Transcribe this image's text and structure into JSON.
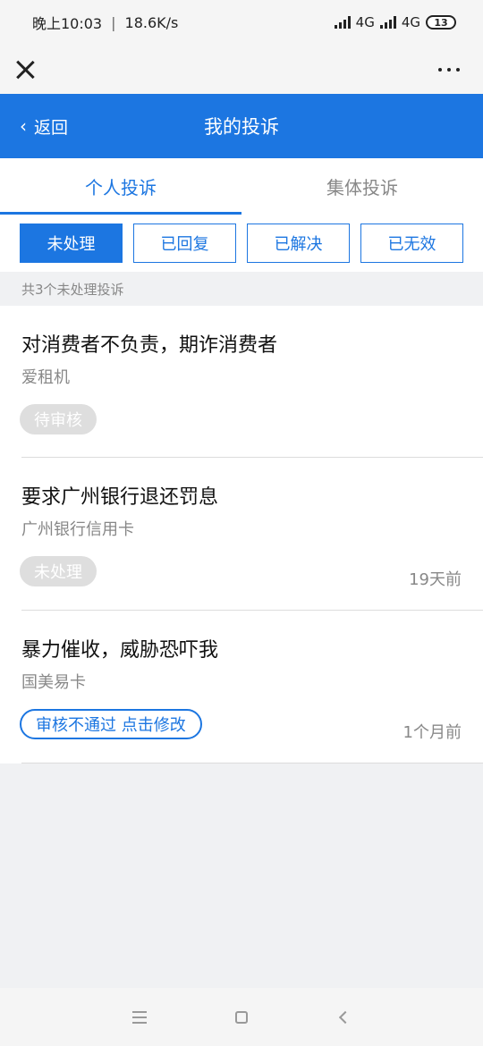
{
  "status": {
    "time": "晚上10:03",
    "separator": "|",
    "speed": "18.6K/s",
    "network1": "4G",
    "network2": "4G",
    "battery": "13"
  },
  "header": {
    "back_label": "返回",
    "title": "我的投诉"
  },
  "tabs": [
    {
      "label": "个人投诉",
      "active": true
    },
    {
      "label": "集体投诉",
      "active": false
    }
  ],
  "filters": [
    {
      "label": "未处理",
      "active": true
    },
    {
      "label": "已回复",
      "active": false
    },
    {
      "label": "已解决",
      "active": false
    },
    {
      "label": "已无效",
      "active": false
    }
  ],
  "summary": "共3个未处理投诉",
  "complaints": [
    {
      "title": "对消费者不负责，期诈消费者",
      "company": "爱租机",
      "status": "待审核",
      "time": ""
    },
    {
      "title": "要求广州银行退还罚息",
      "company": "广州银行信用卡",
      "status": "未处理",
      "time": "19天前"
    },
    {
      "title": "暴力催收，威胁恐吓我",
      "company": "国美易卡",
      "status": "审核不通过 点击修改",
      "time": "1个月前"
    }
  ],
  "colors": {
    "primary": "#1c76e1",
    "badge_gray": "#dedede"
  }
}
